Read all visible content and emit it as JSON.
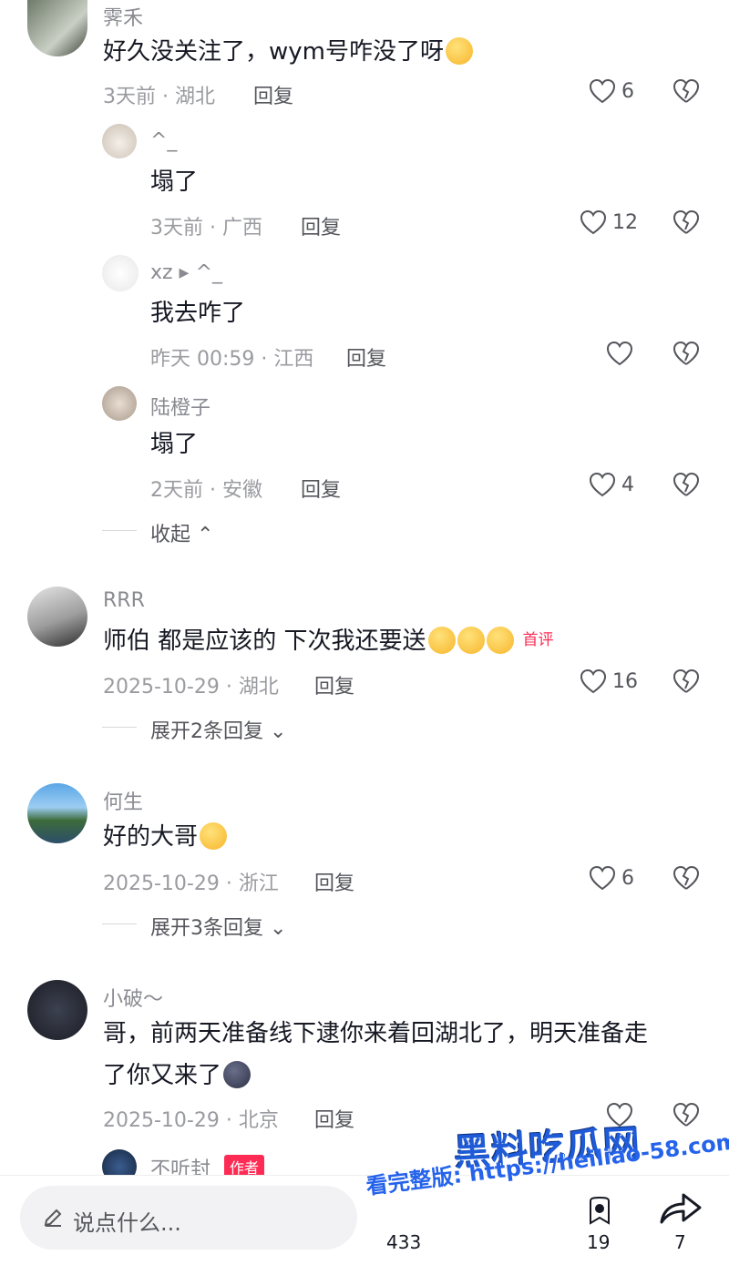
{
  "comments": [
    {
      "user": "霁禾",
      "text": "好久没关注了，wym号咋没了呀",
      "meta": "3天前 · 湖北",
      "reply": "回复",
      "likes": "6",
      "replies": [
        {
          "user": "^_",
          "text": "塌了",
          "meta": "3天前 · 广西",
          "reply": "回复",
          "likes": "12"
        },
        {
          "user": "xz ▸ ^_",
          "text": "我去咋了",
          "meta": "昨天 00:59 · 江西",
          "reply": "回复",
          "likes": ""
        },
        {
          "user": "陆橙子",
          "text": "塌了",
          "meta": "2天前 · 安徽",
          "reply": "回复",
          "likes": "4"
        }
      ],
      "collapse": "收起 ⌃"
    },
    {
      "user": "RRR",
      "text": "师伯 都是应该的 下次我还要送",
      "badge": "首评",
      "meta": "2025-10-29 · 湖北",
      "reply": "回复",
      "likes": "16",
      "expand": "展开2条回复 ⌄"
    },
    {
      "user": "何生",
      "text": "好的大哥",
      "meta": "2025-10-29 · 浙江",
      "reply": "回复",
      "likes": "6",
      "expand": "展开3条回复 ⌄"
    },
    {
      "user": "小破～",
      "text_line1": "哥，前两天准备线下逮你来着回湖北了，明天准备走",
      "text_line2": "了你又来了",
      "meta": "2025-10-29 · 北京",
      "reply": "回复",
      "likes": ""
    },
    {
      "user": "不听封",
      "badge": "作者"
    }
  ],
  "bottom_bar": {
    "input_placeholder": "说点什么...",
    "count_left": "433",
    "count_mid": "19",
    "share_count": "7"
  },
  "watermark": {
    "title": "黑料吃瓜网",
    "url": "看完整版: https://heiliao-58.com"
  },
  "colors": {
    "accent": "#fe2c55",
    "meta": "#9a9ba0",
    "text": "#161823"
  }
}
